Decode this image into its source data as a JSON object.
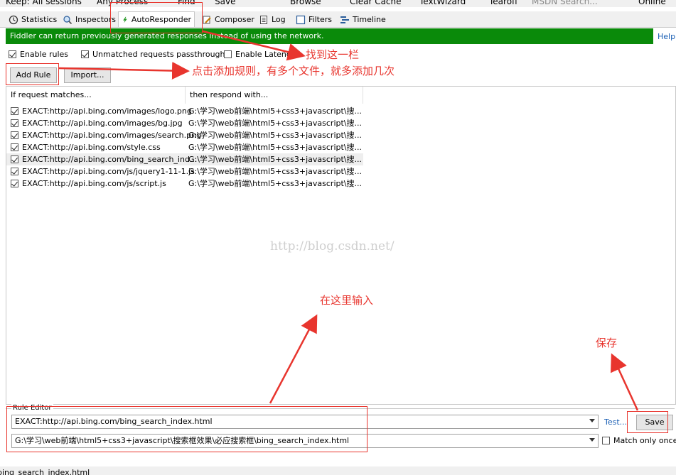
{
  "toolbar": {
    "keep": "Keep: All sessions",
    "process": "Any Process",
    "find": "Find",
    "save": "Save",
    "browse": "Browse",
    "clear_cache": "Clear Cache",
    "textwizard": "TextWizard",
    "tearoff": "Tearoff",
    "msdn_search": "MSDN Search...",
    "online": "Online"
  },
  "tabs": [
    {
      "label": "Statistics"
    },
    {
      "label": "Inspectors"
    },
    {
      "label": "AutoResponder"
    },
    {
      "label": "Composer"
    },
    {
      "label": "Log"
    },
    {
      "label": "Filters"
    },
    {
      "label": "Timeline"
    }
  ],
  "banner": {
    "text": "Fiddler can return previously generated responses instead of using the network.",
    "help": "Help"
  },
  "options": {
    "enable_rules": "Enable rules",
    "passthrough": "Unmatched requests passthrough",
    "latency": "Enable Latency"
  },
  "buttons": {
    "add_rule": "Add Rule",
    "import": "Import..."
  },
  "list": {
    "col1": "If request matches...",
    "col2": "then respond with...",
    "rows": [
      {
        "match": "EXACT:http://api.bing.com/images/logo.png",
        "respond": "G:\\学习\\web前端\\html5+css3+javascript\\搜..."
      },
      {
        "match": "EXACT:http://api.bing.com/images/bg.jpg",
        "respond": "G:\\学习\\web前端\\html5+css3+javascript\\搜..."
      },
      {
        "match": "EXACT:http://api.bing.com/images/search.png",
        "respond": "G:\\学习\\web前端\\html5+css3+javascript\\搜..."
      },
      {
        "match": "EXACT:http://api.bing.com/style.css",
        "respond": "G:\\学习\\web前端\\html5+css3+javascript\\搜..."
      },
      {
        "match": "EXACT:http://api.bing.com/bing_search_ind...",
        "respond": "G:\\学习\\web前端\\html5+css3+javascript\\搜..."
      },
      {
        "match": "EXACT:http://api.bing.com/js/jquery1-11-1.js",
        "respond": "G:\\学习\\web前端\\html5+css3+javascript\\搜..."
      },
      {
        "match": "EXACT:http://api.bing.com/js/script.js",
        "respond": "G:\\学习\\web前端\\html5+css3+javascript\\搜..."
      }
    ]
  },
  "watermark": "http://blog.csdn.net/",
  "rule_editor": {
    "title": "Rule Editor",
    "match_value": "EXACT:http://api.bing.com/bing_search_index.html",
    "respond_value": "G:\\学习\\web前端\\html5+css3+javascript\\搜索框效果\\必应搜索框\\bing_search_index.html",
    "test": "Test...",
    "save": "Save",
    "match_once": "Match only once"
  },
  "annotations": {
    "find_tab": "找到这一栏",
    "add_rule": "点击添加规则，有多个文件，就多添加几次",
    "input_here": "在这里输入",
    "save": "保存"
  },
  "status": "bing_search_index.html",
  "colors": {
    "banner": "#0a8a0a",
    "annotation": "#e8352e",
    "link": "#1a5fb4"
  }
}
